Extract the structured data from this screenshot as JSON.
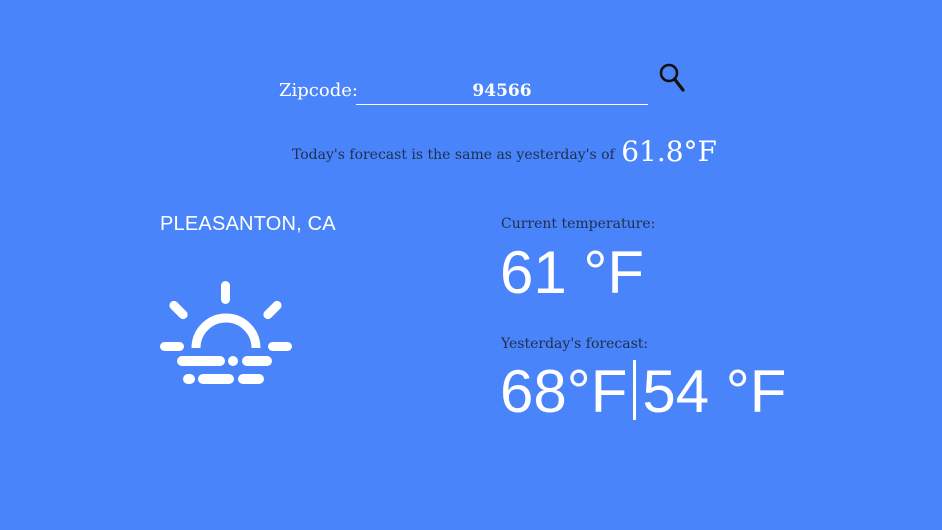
{
  "search": {
    "label": "Zipcode:",
    "value": "94566",
    "icon": "search-icon"
  },
  "comparison": {
    "text": "Today's forecast is the same as yesterday's of",
    "value": "61.8°F"
  },
  "location": {
    "city": "PLEASANTON, CA"
  },
  "condition": {
    "icon": "fog-sunrise-icon"
  },
  "current": {
    "label": "Current temperature:",
    "temp": "61 °F"
  },
  "yesterday": {
    "label": "Yesterday's forecast:",
    "high": "68°F",
    "low": "54 °F"
  },
  "colors": {
    "background": "#4a84fa",
    "text_dark": "#1f2f4d",
    "text_light": "#ffffff"
  }
}
